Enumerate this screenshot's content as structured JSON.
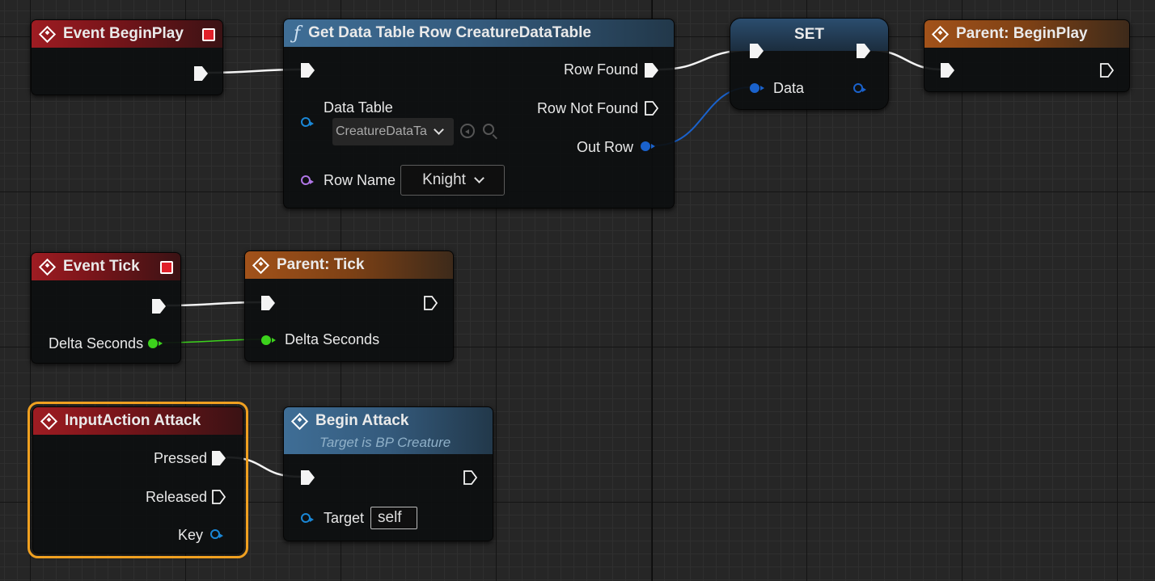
{
  "colors": {
    "event_header": "#9e1c22",
    "function_header": "#3f6e96",
    "parent_header": "#a2521a",
    "set_header": "#2b4d6e",
    "selection_outline": "#f0a020",
    "exec_wire": "#f4f4f4",
    "float_pin": "#3cd21c",
    "struct_pin": "#1a62cc",
    "object_pin": "#1a87d6",
    "name_pin": "#b076e6"
  },
  "nodes": {
    "event_beginplay": {
      "title": "Event BeginPlay",
      "icon": "event-diamond-icon"
    },
    "get_data_table_row": {
      "title": "Get Data Table Row CreatureDataTable",
      "icon": "function-f-icon",
      "pins": {
        "data_table": "Data Table",
        "data_table_value": "CreatureDataTa",
        "row_name": "Row Name",
        "row_name_value": "Knight",
        "row_found": "Row Found",
        "row_not_found": "Row Not Found",
        "out_row": "Out Row"
      }
    },
    "set": {
      "title": "SET",
      "pins": {
        "data": "Data"
      }
    },
    "parent_beginplay": {
      "title": "Parent: BeginPlay",
      "icon": "event-diamond-icon"
    },
    "event_tick": {
      "title": "Event Tick",
      "pins": {
        "delta_seconds": "Delta Seconds"
      }
    },
    "parent_tick": {
      "title": "Parent: Tick",
      "pins": {
        "delta_seconds": "Delta Seconds"
      }
    },
    "inputaction_attack": {
      "title": "InputAction Attack",
      "pins": {
        "pressed": "Pressed",
        "released": "Released",
        "key": "Key"
      }
    },
    "begin_attack": {
      "title": "Begin Attack",
      "subtitle": "Target is BP Creature",
      "pins": {
        "target": "Target",
        "target_value": "self"
      }
    }
  }
}
